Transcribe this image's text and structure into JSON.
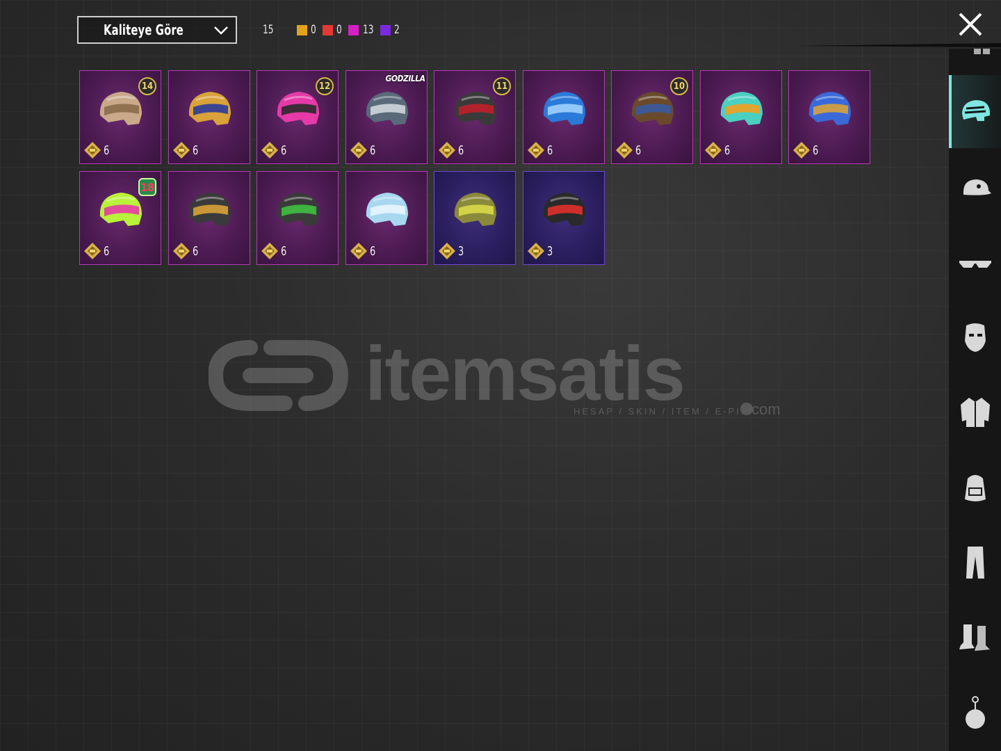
{
  "sort": {
    "label": "Kaliteye Göre"
  },
  "counts": {
    "total": "15",
    "qualities": [
      {
        "color": "#e3a21a",
        "count": "0"
      },
      {
        "color": "#e53935",
        "count": "0"
      },
      {
        "color": "#d61fc5",
        "count": "13"
      },
      {
        "color": "#7c2ae0",
        "count": "2"
      }
    ]
  },
  "items": [
    {
      "name": "helmet-bulldog",
      "value": "6",
      "level": "14",
      "rarity": "legendary-purple",
      "main": "#c9a98a",
      "accent": "#8a6b4a"
    },
    {
      "name": "helmet-pharaoh",
      "value": "6",
      "level": "",
      "rarity": "legendary-purple",
      "main": "#d9a23a",
      "accent": "#2b3b9a"
    },
    {
      "name": "helmet-bunny-pink",
      "value": "6",
      "level": "12",
      "rarity": "legendary-purple",
      "main": "#e53aa8",
      "accent": "#2a2a2a"
    },
    {
      "name": "helmet-godzilla",
      "value": "6",
      "level": "",
      "rarity": "legendary-purple",
      "tag": "GODZILLA",
      "main": "#5a6a7a",
      "accent": "#cfd6dc"
    },
    {
      "name": "helmet-dark-red",
      "value": "6",
      "level": "11",
      "rarity": "legendary-purple",
      "main": "#3a3a3a",
      "accent": "#c0202a"
    },
    {
      "name": "helmet-blue-monster",
      "value": "6",
      "level": "",
      "rarity": "legendary-purple",
      "main": "#2a7ad9",
      "accent": "#9fd0ff"
    },
    {
      "name": "helmet-viking",
      "value": "6",
      "level": "10",
      "rarity": "legendary-purple",
      "main": "#6a4a2a",
      "accent": "#3a5aa0"
    },
    {
      "name": "helmet-dragon",
      "value": "6",
      "level": "",
      "rarity": "legendary-purple",
      "main": "#4ad0c0",
      "accent": "#f0a020"
    },
    {
      "name": "helmet-blue-gold",
      "value": "6",
      "level": "",
      "rarity": "legendary-purple",
      "main": "#3a6ad9",
      "accent": "#d9a23a"
    },
    {
      "name": "helmet-neon-green",
      "value": "6",
      "level": "18",
      "rarity": "legendary-purple",
      "main": "#b9f23a",
      "accent": "#e53aa8"
    },
    {
      "name": "helmet-black-gold",
      "value": "6",
      "level": "",
      "rarity": "legendary-purple",
      "main": "#3a3a3a",
      "accent": "#d9a23a"
    },
    {
      "name": "helmet-christmas",
      "value": "6",
      "level": "",
      "rarity": "legendary-purple",
      "main": "#3a3a3a",
      "accent": "#40c040"
    },
    {
      "name": "helmet-ice",
      "value": "6",
      "level": "",
      "rarity": "legendary-purple",
      "main": "#a8d8f0",
      "accent": "#e8f6ff"
    },
    {
      "name": "helmet-spiked-yellow",
      "value": "3",
      "level": "",
      "rarity": "epic",
      "main": "#8a8a3a",
      "accent": "#d9d94a"
    },
    {
      "name": "helmet-red-white",
      "value": "3",
      "level": "",
      "rarity": "epic",
      "main": "#2a2a2a",
      "accent": "#e0302a"
    }
  ],
  "sidebar": {
    "categories": [
      {
        "name": "helmet",
        "active": true
      },
      {
        "name": "cap",
        "active": false
      },
      {
        "name": "glasses",
        "active": false
      },
      {
        "name": "mask",
        "active": false
      },
      {
        "name": "jacket",
        "active": false
      },
      {
        "name": "backpack",
        "active": false
      },
      {
        "name": "pants",
        "active": false
      },
      {
        "name": "shoes",
        "active": false
      },
      {
        "name": "pendant",
        "active": false
      }
    ]
  },
  "watermark": {
    "brand": "itemsatis",
    "tagline": "HESAP / SKIN / ITEM / E-PIN",
    "domain": ".com"
  }
}
